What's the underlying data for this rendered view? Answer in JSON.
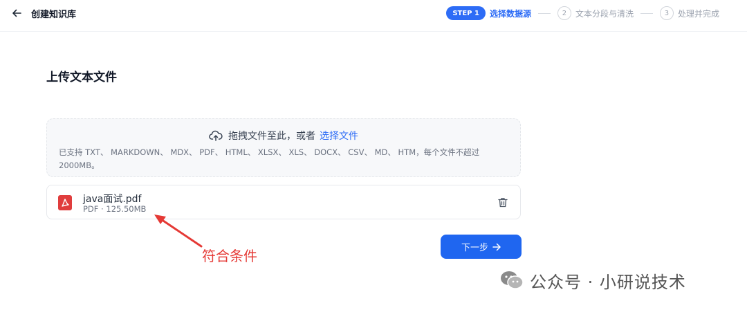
{
  "header": {
    "title": "创建知识库",
    "steps": [
      {
        "badge": "STEP 1",
        "label": "选择数据源",
        "active": true
      },
      {
        "badge": "2",
        "label": "文本分段与清洗",
        "active": false
      },
      {
        "badge": "3",
        "label": "处理并完成",
        "active": false
      }
    ]
  },
  "main": {
    "section_title": "上传文本文件",
    "dropzone": {
      "prompt": "拖拽文件至此，或者",
      "link": "选择文件",
      "support_text": "已支持 TXT、 MARKDOWN、 MDX、 PDF、 HTML、 XLSX、 XLS、 DOCX、 CSV、 MD、 HTM，每个文件不超过 2000MB。"
    },
    "file": {
      "name": "java面试.pdf",
      "meta": "PDF · 125.50MB"
    },
    "next_label": "下一步"
  },
  "annotation": {
    "text": "符合条件",
    "color": "#e53935"
  },
  "watermark": {
    "text": "公众号 · 小研说技术"
  },
  "colors": {
    "accent": "#2d6cf6",
    "pdf": "#e03d3d"
  }
}
